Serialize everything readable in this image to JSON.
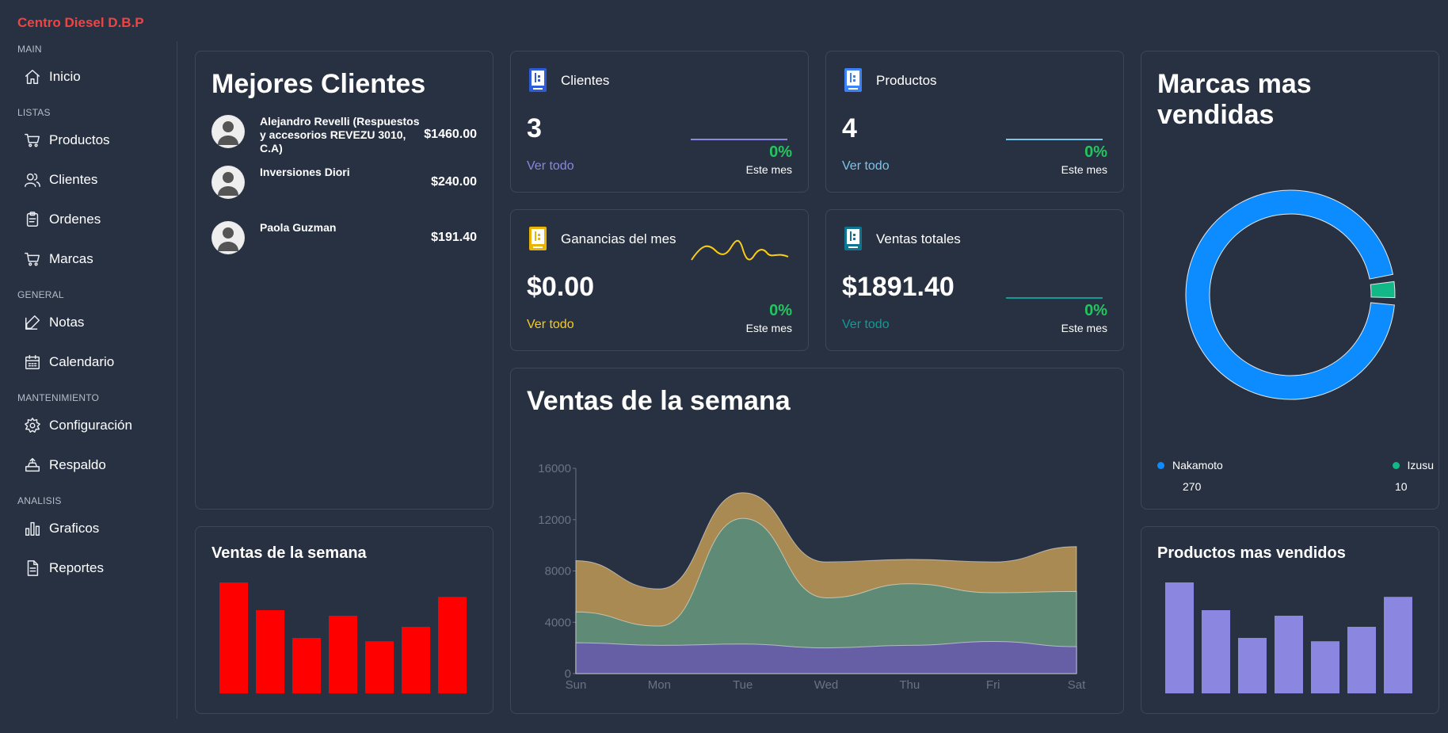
{
  "app": {
    "brand": "Centro Diesel D.B.P"
  },
  "sidebar": {
    "sections": [
      {
        "title": "MAIN",
        "items": [
          {
            "label": "Inicio",
            "icon": "home-icon"
          }
        ]
      },
      {
        "title": "LISTAS",
        "items": [
          {
            "label": "Productos",
            "icon": "cart-icon"
          },
          {
            "label": "Clientes",
            "icon": "users-icon"
          },
          {
            "label": "Ordenes",
            "icon": "clipboard-icon"
          },
          {
            "label": "Marcas",
            "icon": "cart-icon"
          }
        ]
      },
      {
        "title": "GENERAL",
        "items": [
          {
            "label": "Notas",
            "icon": "edit-icon"
          },
          {
            "label": "Calendario",
            "icon": "calendar-icon"
          }
        ]
      },
      {
        "title": "MANTENIMIENTO",
        "items": [
          {
            "label": "Configuración",
            "icon": "gear-icon"
          },
          {
            "label": "Respaldo",
            "icon": "backup-icon"
          }
        ]
      },
      {
        "title": "ANALISIS",
        "items": [
          {
            "label": "Graficos",
            "icon": "bar-chart-icon"
          },
          {
            "label": "Reportes",
            "icon": "document-icon"
          }
        ]
      }
    ]
  },
  "best_clients": {
    "title": "Mejores Clientes",
    "clients": [
      {
        "name": "Alejandro Revelli (Respuestos y accesorios REVEZU 3010, C.A)",
        "amount": "$1460.00"
      },
      {
        "name": "Inversiones Diori",
        "amount": "$240.00"
      },
      {
        "name": "Paola Guzman",
        "amount": "$191.40"
      }
    ]
  },
  "stats": {
    "clientes": {
      "title": "Clientes",
      "value": "3",
      "link": "Ver todo",
      "pct": "0%",
      "sub": "Este mes",
      "color": "#8b86e0"
    },
    "productos": {
      "title": "Productos",
      "value": "4",
      "link": "Ver todo",
      "pct": "0%",
      "sub": "Este mes",
      "color": "#7cc4e8"
    },
    "ganancias": {
      "title": "Ganancias del mes",
      "value": "$0.00",
      "link": "Ver todo",
      "pct": "0%",
      "sub": "Este mes",
      "color": "#facc15"
    },
    "ventas": {
      "title": "Ventas totales",
      "value": "$1891.40",
      "link": "Ver todo",
      "pct": "0%",
      "sub": "Este mes",
      "color": "#0f9b96"
    }
  },
  "weekly_area": {
    "title": "Ventas de la semana",
    "chart_data": {
      "type": "area",
      "categories": [
        "Sun",
        "Mon",
        "Tue",
        "Wed",
        "Thu",
        "Fri",
        "Sat"
      ],
      "ylim": [
        0,
        16000
      ],
      "yticks": [
        "0",
        "4000",
        "8000",
        "12000",
        "16000"
      ],
      "series": [
        {
          "values": [
            2400,
            2200,
            2300,
            2000,
            2200,
            2500,
            2100
          ],
          "color": "#675fa5"
        },
        {
          "values": [
            2400,
            1500,
            9800,
            3900,
            4800,
            3800,
            4300
          ],
          "color": "#5f8a76"
        },
        {
          "values": [
            4000,
            2900,
            2000,
            2800,
            1900,
            2400,
            3500
          ],
          "color": "#a88a52"
        }
      ]
    }
  },
  "brands": {
    "title": "Marcas mas vendidas",
    "chart_data": {
      "type": "pie",
      "labels": [
        "Nakamoto",
        "Izusu"
      ],
      "values": [
        270,
        10
      ],
      "colors": [
        "#0d8cff",
        "#12b886"
      ]
    },
    "legend": [
      {
        "label": "Nakamoto",
        "value": "270",
        "color": "#0d8cff"
      },
      {
        "label": "Izusu",
        "value": "10",
        "color": "#12b886"
      }
    ]
  },
  "weekly_bars": {
    "title": "Ventas de la semana",
    "chart_data": {
      "type": "bar",
      "values": [
        100,
        75,
        50,
        70,
        47,
        60,
        87
      ],
      "ylim": [
        0,
        100
      ],
      "color": "#ff0000"
    }
  },
  "top_products": {
    "title": "Productos mas vendidos",
    "chart_data": {
      "type": "bar",
      "values": [
        100,
        75,
        50,
        70,
        47,
        60,
        87
      ],
      "ylim": [
        0,
        100
      ],
      "color": "#8b86e0"
    }
  }
}
